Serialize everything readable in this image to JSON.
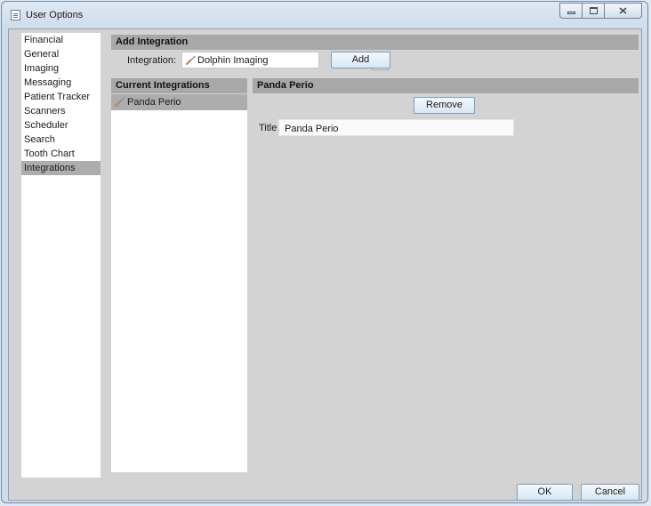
{
  "window": {
    "title": "User Options"
  },
  "nav": {
    "items": [
      {
        "label": "Financial"
      },
      {
        "label": "General"
      },
      {
        "label": "Imaging"
      },
      {
        "label": "Messaging"
      },
      {
        "label": "Patient Tracker"
      },
      {
        "label": "Scanners"
      },
      {
        "label": "Scheduler"
      },
      {
        "label": "Search"
      },
      {
        "label": "Tooth Chart"
      },
      {
        "label": "Integrations",
        "selected": true
      }
    ]
  },
  "add_integration": {
    "header": "Add Integration",
    "label": "Integration:",
    "selected_value": "Dolphin Imaging",
    "add_button": "Add"
  },
  "current_integrations": {
    "header": "Current Integrations",
    "items": [
      {
        "label": "Panda Perio",
        "selected": true
      }
    ]
  },
  "detail": {
    "header": "Panda Perio",
    "remove_button": "Remove",
    "title_label": "Title",
    "title_value": "Panda Perio"
  },
  "footer": {
    "ok_button": "OK",
    "cancel_button": "Cancel"
  }
}
